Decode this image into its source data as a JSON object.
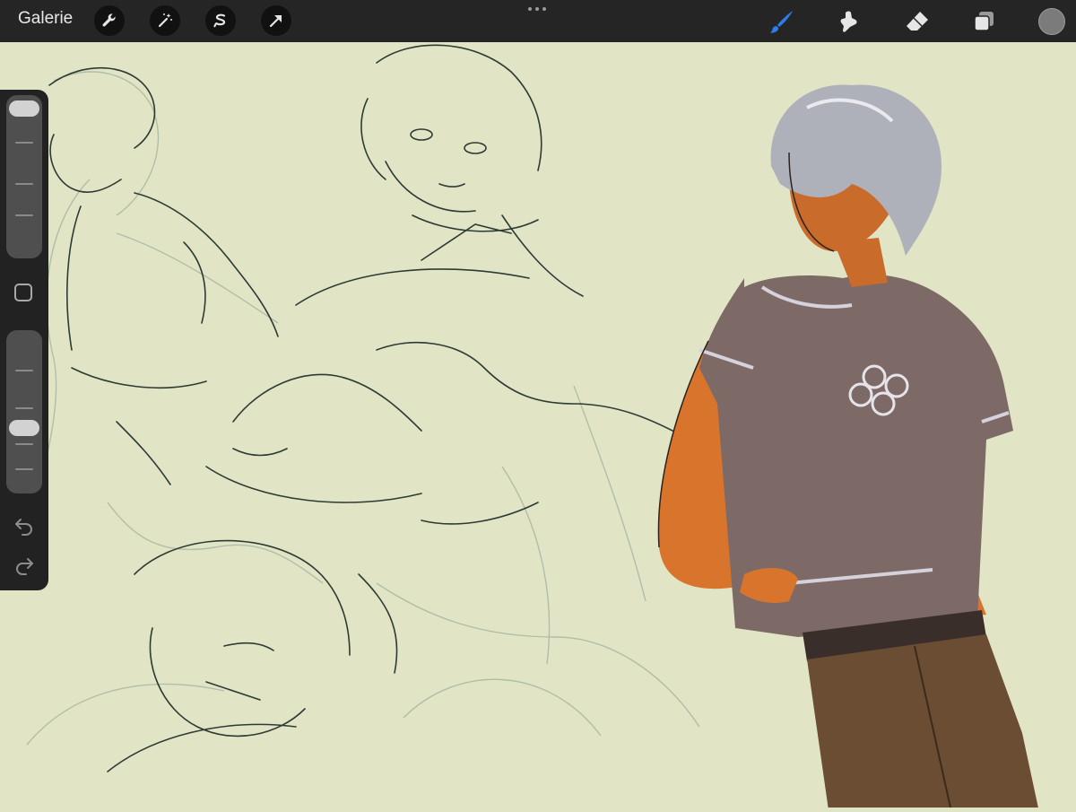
{
  "topbar": {
    "gallery_label": "Galerie",
    "left_tools": [
      "wrench-icon",
      "magic-wand-icon",
      "selection-icon",
      "transform-arrow-icon"
    ],
    "right_tools": [
      "brush-icon",
      "smudge-icon",
      "eraser-icon",
      "layers-icon"
    ],
    "active_tool": "brush-icon",
    "active_color": "#2f7bf0",
    "current_color": "#7b7b7b"
  },
  "sidebar": {
    "brush_size_level": 1.0,
    "opacity_level": 0.38,
    "controls": [
      "brush-size-slider",
      "modifier-button",
      "opacity-slider",
      "undo-icon",
      "redo-icon"
    ]
  },
  "canvas": {
    "background_color": "#e1e5c6",
    "content": "artwork"
  }
}
